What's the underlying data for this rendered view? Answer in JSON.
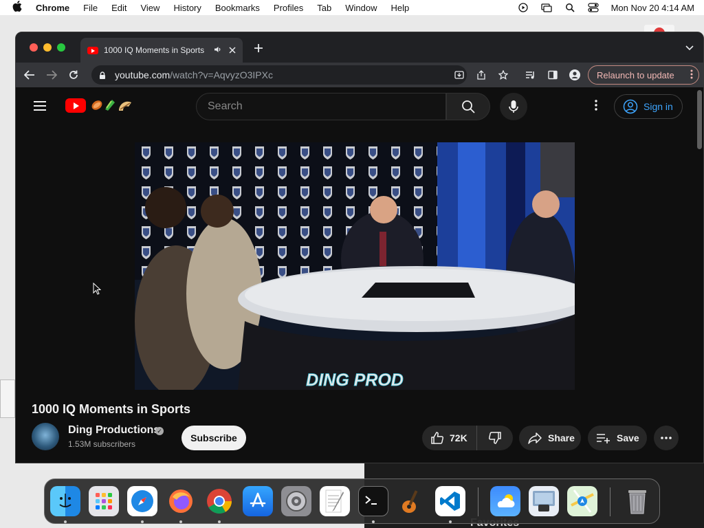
{
  "menubar": {
    "app_name": "Chrome",
    "items": [
      "File",
      "Edit",
      "View",
      "History",
      "Bookmarks",
      "Profiles",
      "Tab",
      "Window",
      "Help"
    ],
    "clock": "Mon Nov 20  4:14 AM"
  },
  "browser": {
    "tab_title": "1000 IQ Moments in Sports",
    "url_host": "youtube.com",
    "url_path": "/watch?v=AqvyzO3IPXc",
    "relaunch_label": "Relaunch to update"
  },
  "youtube": {
    "search_placeholder": "Search",
    "sign_in_label": "Sign in",
    "video": {
      "title": "1000 IQ Moments in Sports",
      "watermark": "DING PROD"
    },
    "channel": {
      "name": "Ding Productions",
      "subscribers": "1.53M subscribers"
    },
    "actions": {
      "subscribe_label": "Subscribe",
      "likes": "72K",
      "share_label": "Share",
      "save_label": "Save"
    }
  },
  "colors": {
    "yt_red": "#ff0000",
    "link_blue": "#3ea6ff",
    "relaunch_text": "#f2b8b5"
  },
  "dock": {
    "apps": [
      "finder-icon",
      "launchpad-icon",
      "safari-icon",
      "firefox-icon",
      "chrome-icon",
      "app-store-icon",
      "system-settings-icon",
      "textedit-icon",
      "terminal-icon",
      "garageband-icon",
      "vscode-icon",
      "weather-icon",
      "preview-icon",
      "maps-icon",
      "trash-icon"
    ]
  },
  "desktop": {
    "right_text": "Favorites"
  }
}
